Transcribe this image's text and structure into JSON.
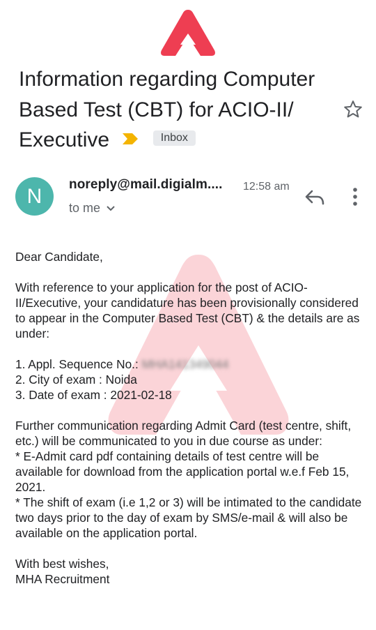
{
  "colors": {
    "brand_red": "#ee3e52",
    "avatar": "#4db6ac",
    "importance": "#f4b400",
    "label_bg": "#e8eaed"
  },
  "branding": {
    "logo": "adda247-triangle-logo"
  },
  "subject": {
    "text": "Information regarding Computer Based Test (CBT) for ACIO-II/ Executive",
    "importance_icon": "importance-marker-icon",
    "label": "Inbox",
    "star_icon": "star-outline-icon"
  },
  "sender": {
    "avatar_letter": "N",
    "address": "noreply@mail.digialm....",
    "time": "12:58 am",
    "recipient": "to me",
    "icons": [
      "chevron-down-icon",
      "reply-icon",
      "more-vert-icon"
    ]
  },
  "message": {
    "greeting": "Dear Candidate,",
    "intro": "With reference to your application for the post of ACIO-II/Executive, your candidature has been provisionally considered to appear in the Computer Based Test (CBT) & the details are as under:",
    "item1_label": "1. Appl. Sequence No.:",
    "item1_value": "MHA141349044",
    "item2": "2. City of exam : Noida",
    "item3": "3. Date of exam : 2021-02-18",
    "further": "Further communication regarding Admit Card (test centre, shift, etc.) will be communicated to you in due course as under:",
    "bullet1": "* E-Admit card pdf containing details of test centre will be available for download from the application portal w.e.f Feb 15, 2021.",
    "bullet2": "* The shift of exam (i.e 1,2 or 3) will be intimated to the candidate two days prior to the day of exam by SMS/e-mail & will also be available on the application portal.",
    "closing": "With best wishes,",
    "signature": "MHA Recruitment"
  }
}
